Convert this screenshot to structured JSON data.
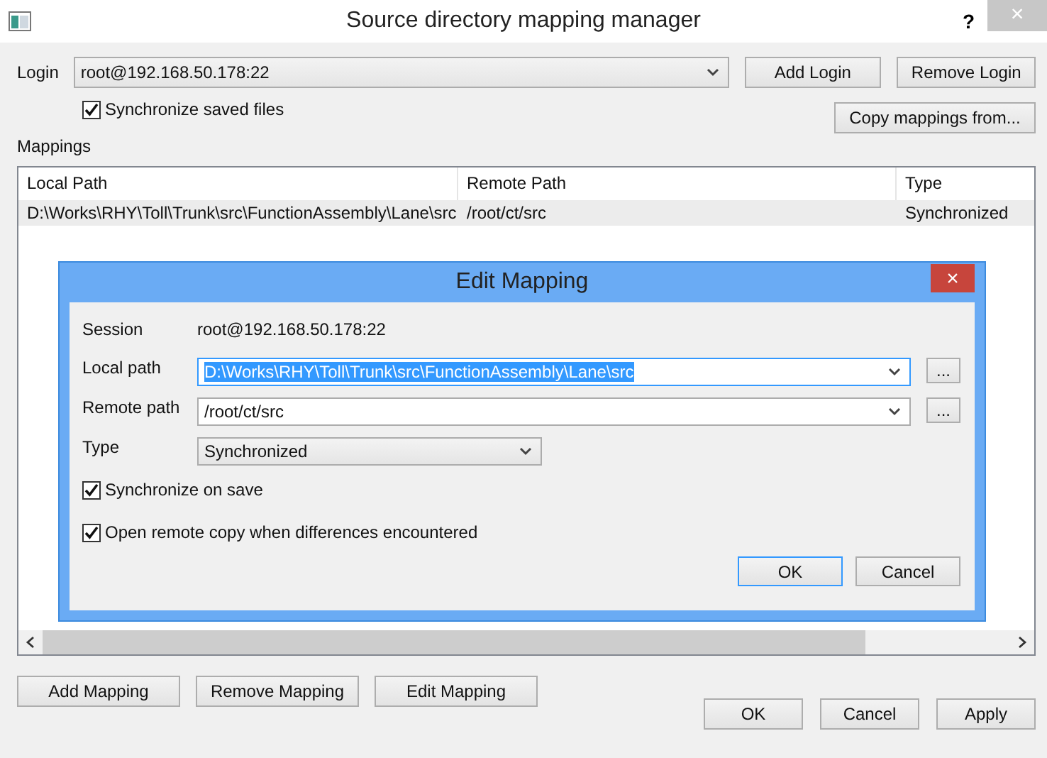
{
  "window": {
    "title": "Source directory mapping manager",
    "help": "?",
    "close": "×"
  },
  "login": {
    "label": "Login",
    "value": "root@192.168.50.178:22",
    "buttons": [
      "Add Login",
      "Remove Login"
    ]
  },
  "sync_saved": {
    "label": "Synchronize saved files",
    "checked": true
  },
  "copy_button": "Copy mappings from...",
  "mappings_label": "Mappings",
  "table": {
    "columns": [
      "Local Path",
      "Remote Path",
      "Type"
    ],
    "rows": [
      {
        "cells": [
          "D:\\Works\\RHY\\Toll\\Trunk\\src\\FunctionAssembly\\Lane\\src",
          "/root/ct/src",
          "Synchronized"
        ],
        "selected": true
      }
    ]
  },
  "mapping_buttons": [
    "Add Mapping",
    "Remove Mapping",
    "Edit Mapping"
  ],
  "dialog_buttons": [
    "OK",
    "Cancel",
    "Apply"
  ],
  "edit_dialog": {
    "title": "Edit Mapping",
    "close": "×",
    "fields": [
      {
        "kind": "text",
        "label": "Session",
        "value": "root@192.168.50.178:22"
      },
      {
        "kind": "path",
        "label": "Local path",
        "value": "D:\\Works\\RHY\\Toll\\Trunk\\src\\FunctionAssembly\\Lane\\src",
        "focused": true,
        "browse": "..."
      },
      {
        "kind": "path",
        "label": "Remote path",
        "value": "/root/ct/src",
        "focused": false,
        "browse": "..."
      },
      {
        "kind": "combo",
        "label": "Type",
        "value": "Synchronized"
      }
    ],
    "checkboxes": [
      {
        "label": "Synchronize on save",
        "checked": true
      },
      {
        "label": "Open remote copy when differences encountered",
        "checked": true
      }
    ],
    "buttons": [
      {
        "label": "OK",
        "default": true
      },
      {
        "label": "Cancel",
        "default": false
      }
    ]
  }
}
